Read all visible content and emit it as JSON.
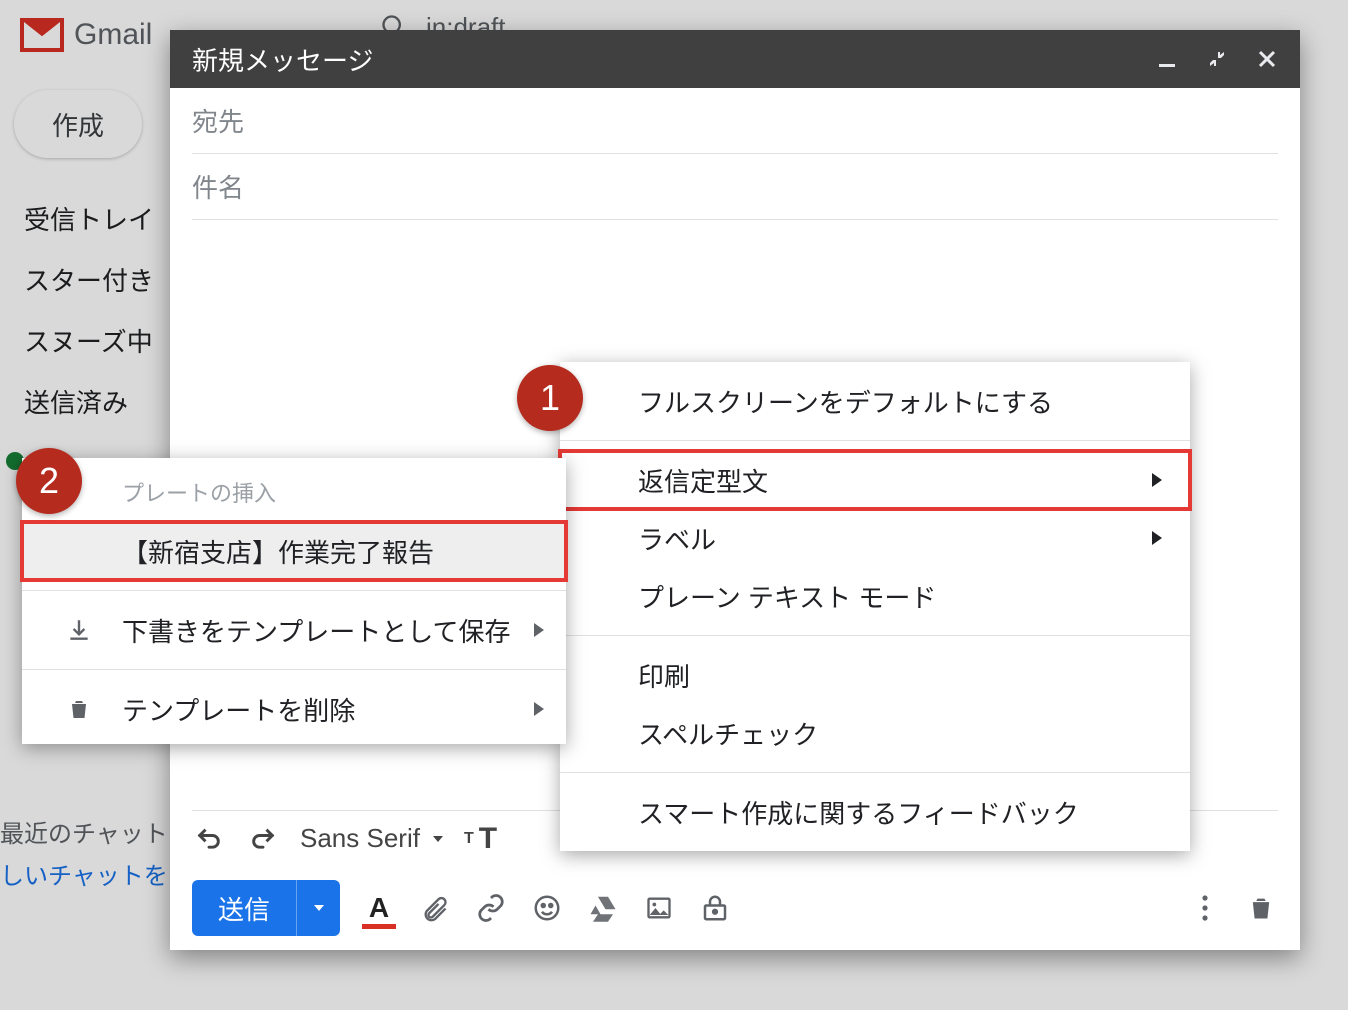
{
  "app": {
    "name": "Gmail"
  },
  "search": {
    "query": "in:draft"
  },
  "sidebar": {
    "compose_label": "作成",
    "items": [
      {
        "label": "受信トレイ"
      },
      {
        "label": "スター付き"
      },
      {
        "label": "スヌーズ中"
      },
      {
        "label": "送信済み"
      }
    ],
    "chat_header": "最近のチャット",
    "chat_link": "しいチャットを"
  },
  "compose": {
    "title": "新規メッセージ",
    "to_placeholder": "宛先",
    "subject_placeholder": "件名",
    "font_family": "Sans Serif",
    "send_label": "送信"
  },
  "more_menu": {
    "fullscreen_default": "フルスクリーンをデフォルトにする",
    "canned_responses": "返信定型文",
    "label": "ラベル",
    "plain_text": "プレーン テキスト モード",
    "print": "印刷",
    "spellcheck": "スペルチェック",
    "smart_compose_feedback": "スマート作成に関するフィードバック"
  },
  "template_menu": {
    "insert_header": "プレートの挿入",
    "template_name": "【新宿支店】作業完了報告",
    "save_draft_as_template": "下書きをテンプレートとして保存",
    "delete_template": "テンプレートを削除"
  },
  "callouts": {
    "one": "1",
    "two": "2"
  },
  "colors": {
    "accent": "#1a73e8",
    "callout": "#b52c1f",
    "highlight": "#e53935"
  }
}
